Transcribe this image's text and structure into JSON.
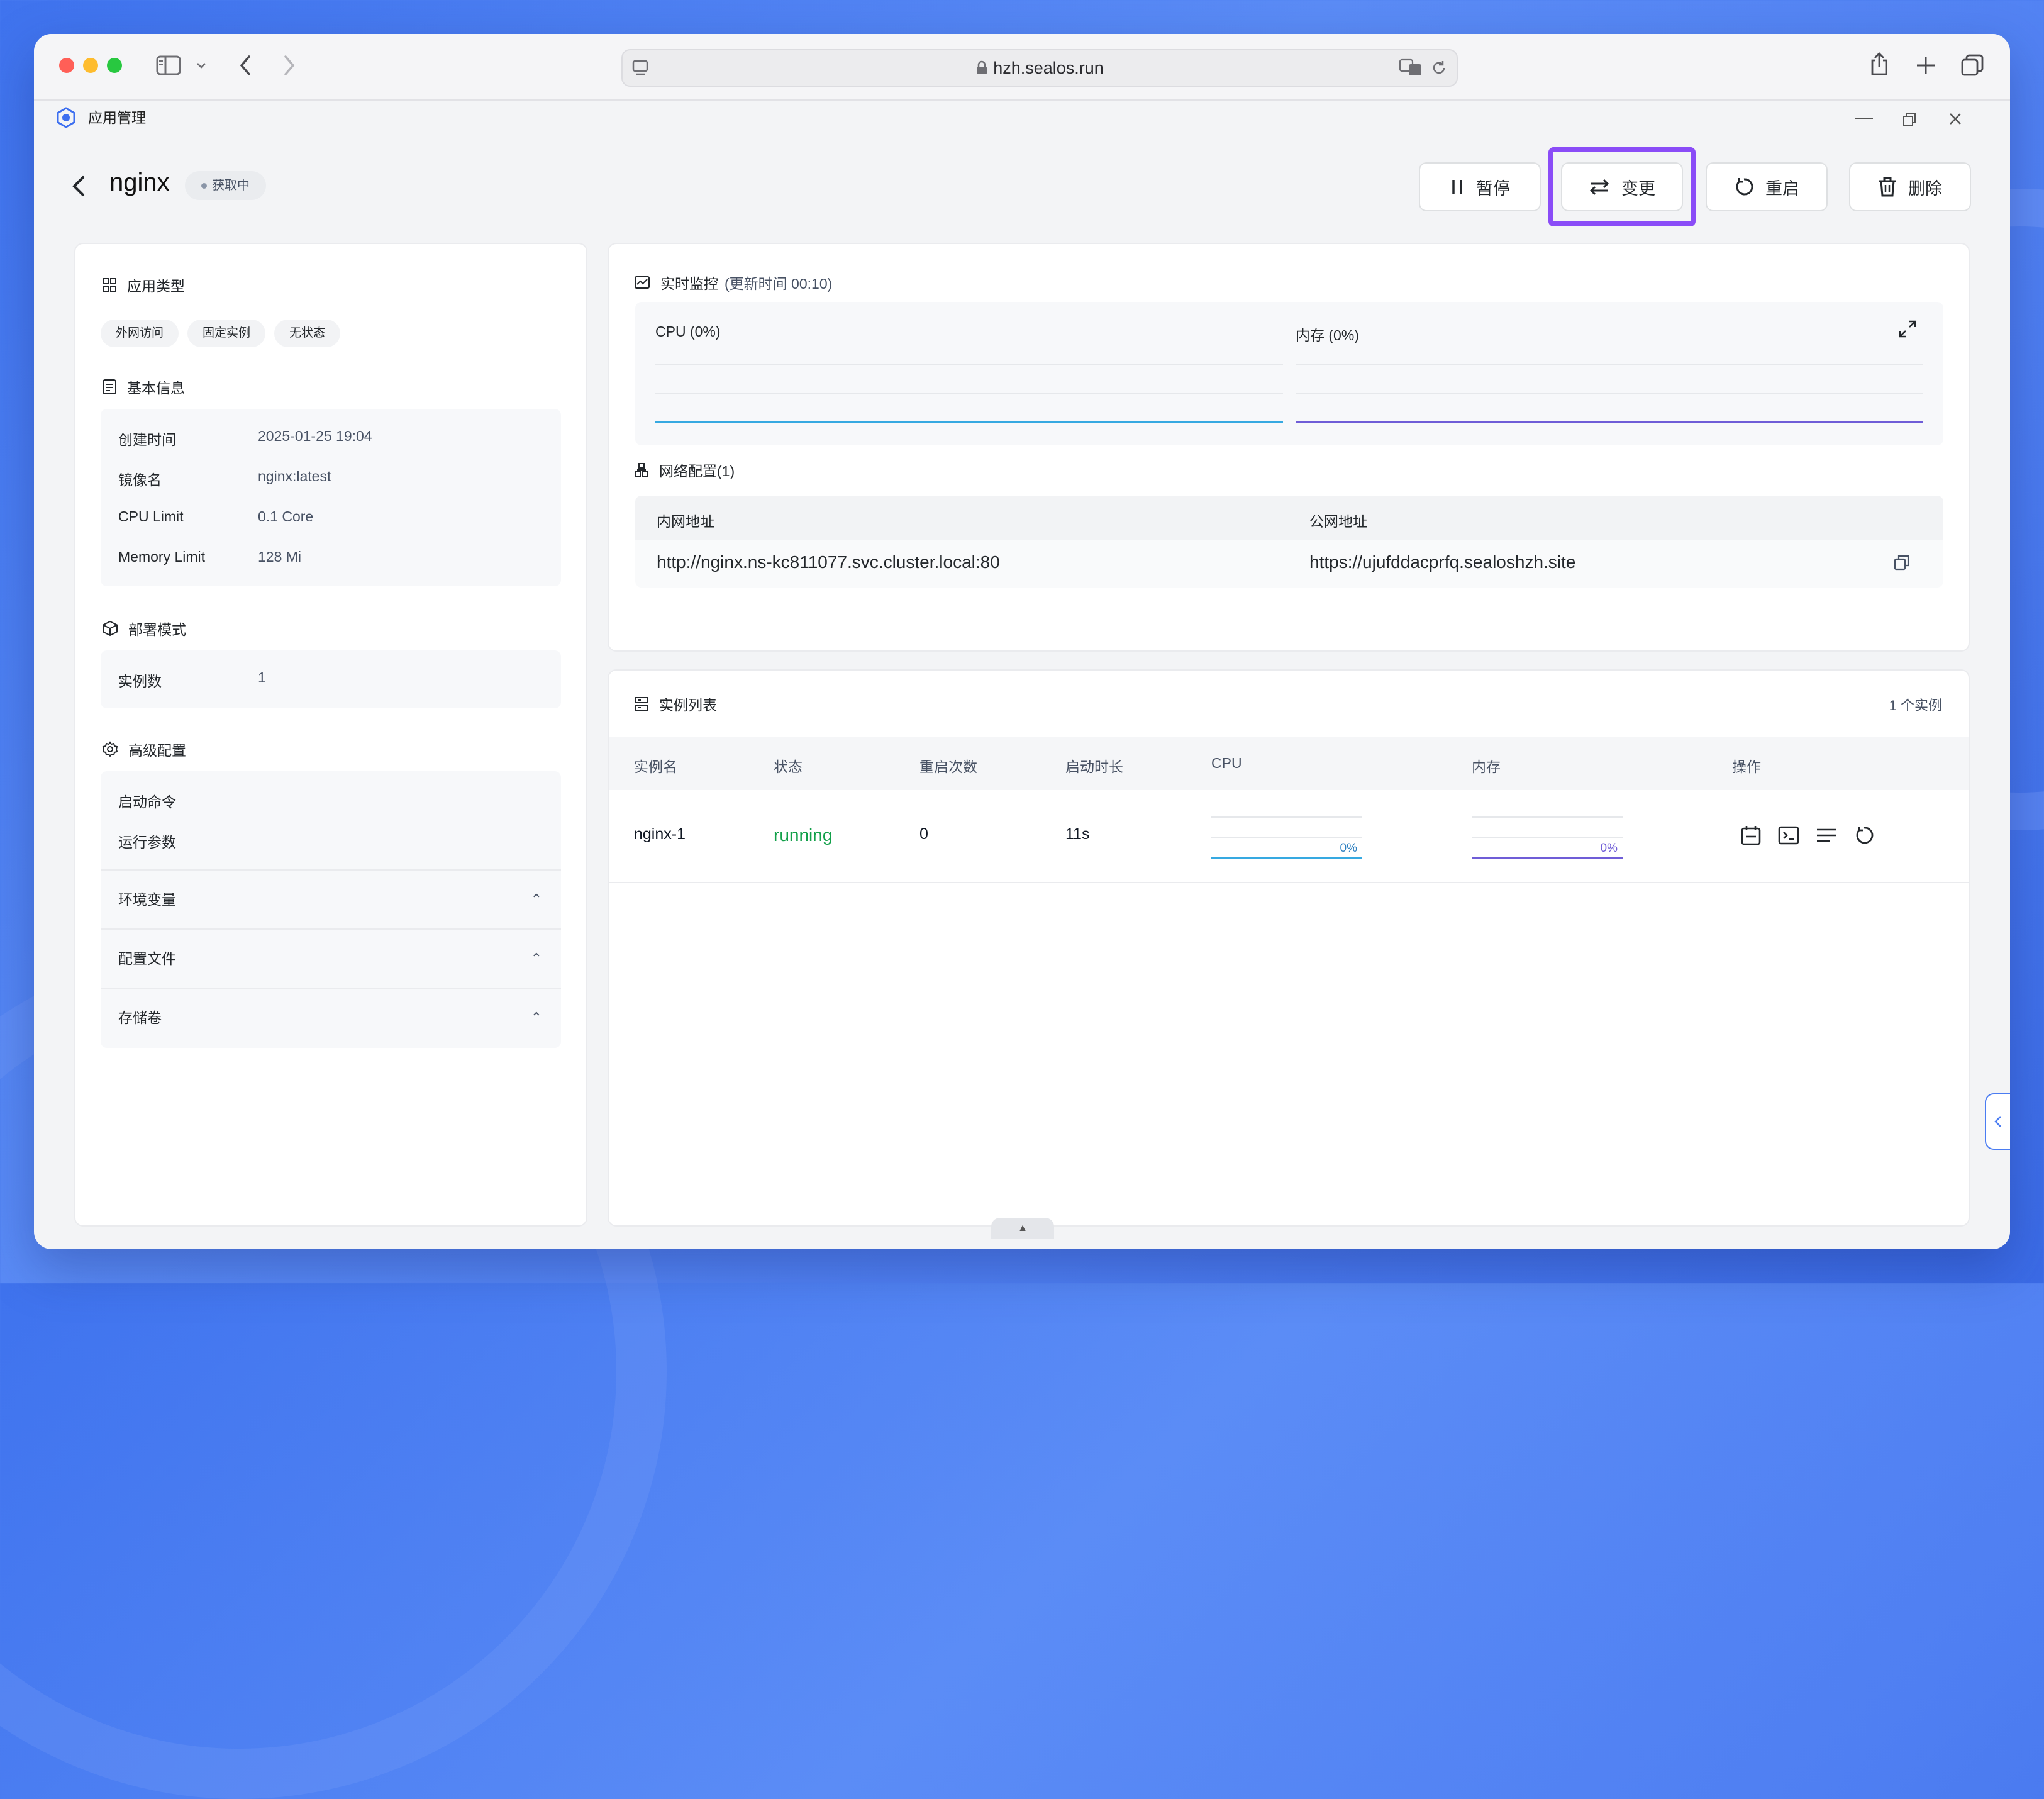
{
  "browser": {
    "url": "hzh.sealos.run"
  },
  "app": {
    "title": "应用管理"
  },
  "header": {
    "app_name": "nginx",
    "status": "获取中",
    "buttons": {
      "pause": "暂停",
      "update": "变更",
      "restart": "重启",
      "delete": "删除"
    }
  },
  "left": {
    "app_type": {
      "title": "应用类型",
      "tags": [
        "外网访问",
        "固定实例",
        "无状态"
      ]
    },
    "basic_info": {
      "title": "基本信息",
      "rows": [
        {
          "key": "创建时间",
          "value": "2025-01-25 19:04"
        },
        {
          "key": "镜像名",
          "value": "nginx:latest"
        },
        {
          "key": "CPU Limit",
          "value": "0.1 Core"
        },
        {
          "key": "Memory Limit",
          "value": "128 Mi"
        }
      ]
    },
    "deploy_mode": {
      "title": "部署模式",
      "key": "实例数",
      "value": "1"
    },
    "advanced": {
      "title": "高级配置",
      "start_cmd": "启动命令",
      "run_args": "运行参数",
      "sections": [
        "环境变量",
        "配置文件",
        "存储卷"
      ]
    }
  },
  "monitor": {
    "title": "实时监控",
    "updated": "(更新时间  00:10)",
    "cpu_label": "CPU  (0%)",
    "mem_label": "内存  (0%)",
    "cpu_color": "#36a9e1",
    "mem_color": "#6f5dd7"
  },
  "network": {
    "title": "网络配置(1)",
    "col_internal": "内网地址",
    "col_public": "公网地址",
    "internal": "http://nginx.ns-kc811077.svc.cluster.local:80",
    "public": "https://ujufddacprfq.sealoshzh.site"
  },
  "instances": {
    "title": "实例列表",
    "count": "1 个实例",
    "columns": [
      "实例名",
      "状态",
      "重启次数",
      "启动时长",
      "CPU",
      "内存",
      "操作"
    ],
    "rows": [
      {
        "name": "nginx-1",
        "status": "running",
        "restarts": "0",
        "uptime": "11s",
        "cpu": "0%",
        "mem": "0%"
      }
    ],
    "status_color": "#13a04a"
  }
}
